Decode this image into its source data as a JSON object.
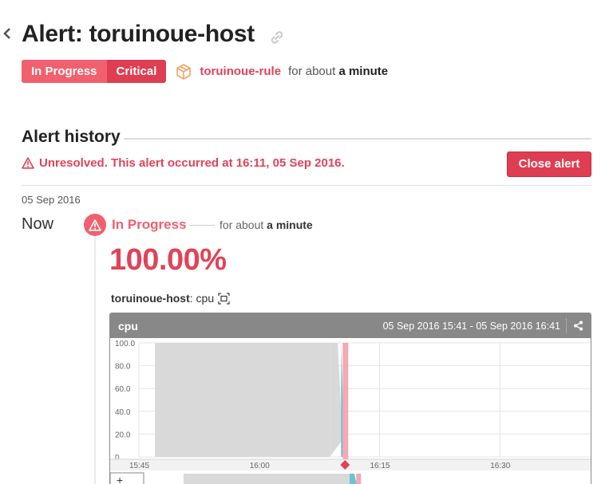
{
  "header": {
    "title": "Alert: toruinoue-host",
    "icons": {
      "back": "chevron-left-icon",
      "link": "link-icon"
    }
  },
  "status": {
    "state": "In Progress",
    "severity": "Critical",
    "rule_name": "toruinoue-rule",
    "duration_prefix": "for about",
    "duration_value": "a minute",
    "colors": {
      "state": "#f0606e",
      "severity": "#df3d51",
      "rule": "#e04358",
      "rule_icon": "#f0a560"
    }
  },
  "history": {
    "section_title": "Alert history",
    "unresolved_message": "Unresolved. This alert occurred at 16:11, 05 Sep 2016.",
    "close_button": "Close alert",
    "date": "05 Sep 2016",
    "now_label": "Now",
    "event": {
      "status": "In Progress",
      "duration_prefix": "for about",
      "duration_value": "a minute",
      "value": "100.00%",
      "host": "toruinoue-host",
      "metric_suffix": ": cpu"
    }
  },
  "graph": {
    "title": "cpu",
    "time_range": "05 Sep 2016 15:41 - 05 Sep 2016 16:41",
    "y_ticks": [
      "0",
      "20.0",
      "40.0",
      "60.0",
      "80.0",
      "100.0"
    ],
    "x_ticks": [
      "15:45",
      "16:00",
      "16:15",
      "16:30"
    ],
    "zoom_plus": "+",
    "colors": {
      "gray_area": "#d9d9d9",
      "cpu_area": "#6cc3d0",
      "alert_band": "#f4a9b4",
      "marker": "#e04358"
    }
  },
  "chart_data": {
    "type": "area",
    "title": "cpu",
    "x": [
      "15:47",
      "16:09",
      "16:10",
      "16:11"
    ],
    "series": [
      {
        "values": [
          100,
          100,
          15,
          100
        ]
      }
    ],
    "xlabel": "",
    "ylabel": "",
    "ylim": [
      0,
      100
    ],
    "x_ticks": [
      "15:45",
      "16:00",
      "16:15",
      "16:30"
    ],
    "alert_time": "16:11",
    "grid": true
  }
}
